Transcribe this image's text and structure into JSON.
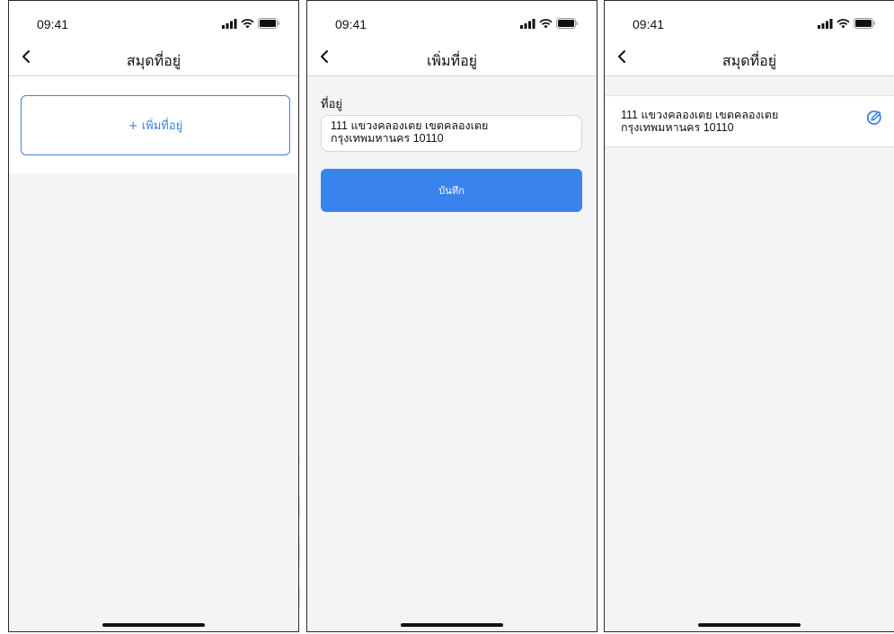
{
  "screens": [
    {
      "status": {
        "time": "09:41"
      },
      "nav": {
        "title": "สมุดที่อยู่"
      },
      "add_button_label": "+ เพิ่มที่อยู่"
    },
    {
      "status": {
        "time": "09:41"
      },
      "nav": {
        "title": "เพิ่มที่อยู่"
      },
      "form": {
        "address_label": "ที่อยู่",
        "address_line1": "111 แขวงคลองเตย เขตคลองเตย",
        "address_line2": "กรุงเทพมหานคร 10110",
        "save_label": "บันทึก"
      }
    },
    {
      "status": {
        "time": "09:41"
      },
      "nav": {
        "title": "สมุดที่อยู่"
      },
      "address_item": {
        "line1": "111 แขวงคลองเตย เขตคลองเตย",
        "line2": "กรุงเทพมหานคร 10110"
      }
    }
  ],
  "icons": {
    "back": "chevron-left-icon",
    "signal": "cellular-signal-icon",
    "wifi": "wifi-icon",
    "battery": "battery-icon",
    "edit": "edit-icon"
  },
  "colors": {
    "accent": "#3b82f0",
    "screen_background": "#f3f4f6",
    "surface": "#ffffff"
  }
}
